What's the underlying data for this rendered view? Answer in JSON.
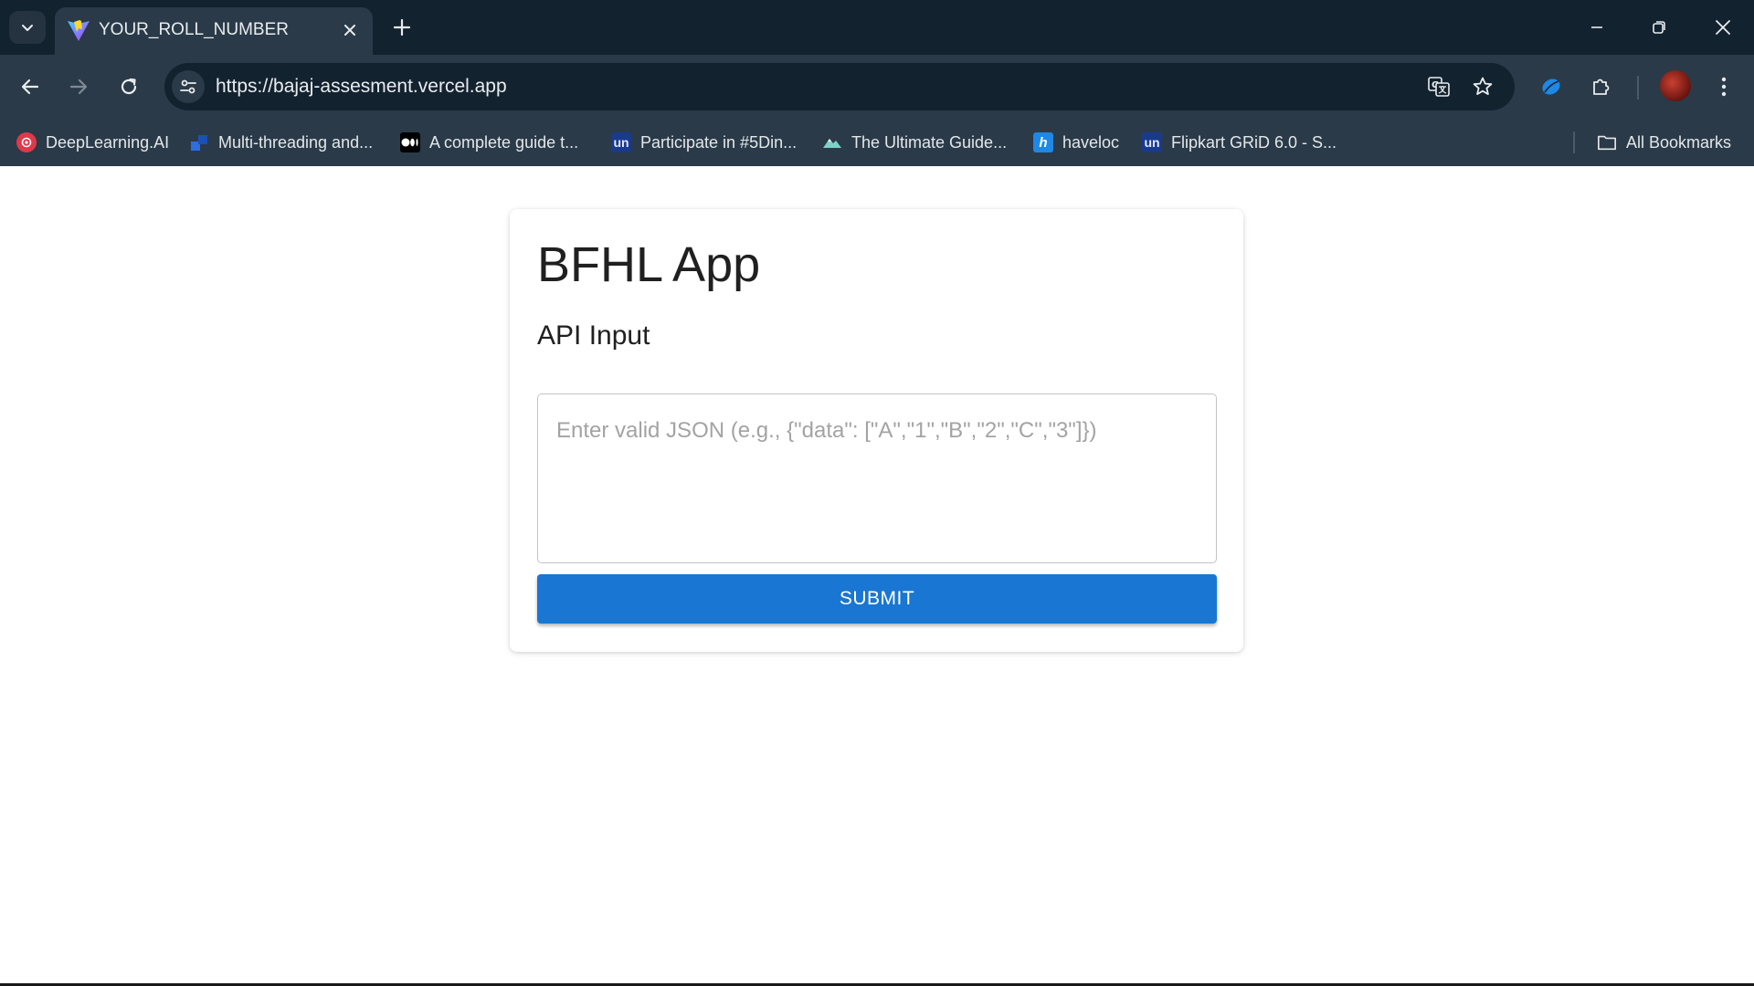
{
  "browser": {
    "tab": {
      "title": "YOUR_ROLL_NUMBER",
      "favicon": "vite-logo-icon"
    },
    "address_bar": {
      "url": "https://bajaj-assesment.vercel.app"
    },
    "bookmarks": [
      {
        "label": "DeepLearning.AI",
        "icon": "deeplearning-ai-icon",
        "color": "#e0384b"
      },
      {
        "label": "Multi-threading and...",
        "icon": "blue-blocks-icon",
        "color": "#2f6de0"
      },
      {
        "label": "A complete guide t...",
        "icon": "medium-icon",
        "color": "#000000"
      },
      {
        "label": "Participate in #5Din...",
        "icon": "unstop-icon",
        "color": "#1a3a8c"
      },
      {
        "label": "The Ultimate Guide...",
        "icon": "mountain-icon",
        "color": "#7fd0c8"
      },
      {
        "label": "haveloc",
        "icon": "haveloc-icon",
        "color": "#1e88e5"
      },
      {
        "label": "Flipkart GRiD 6.0 - S...",
        "icon": "unstop-icon",
        "color": "#1a3a8c"
      }
    ],
    "all_bookmarks_label": "All Bookmarks"
  },
  "app": {
    "title": "BFHL App",
    "section_title": "API Input",
    "input": {
      "value": "",
      "placeholder": "Enter valid JSON (e.g., {\"data\": [\"A\",\"1\",\"B\",\"2\",\"C\",\"3\"]})"
    },
    "submit_label": "SUBMIT",
    "accent_color": "#1976d2"
  }
}
